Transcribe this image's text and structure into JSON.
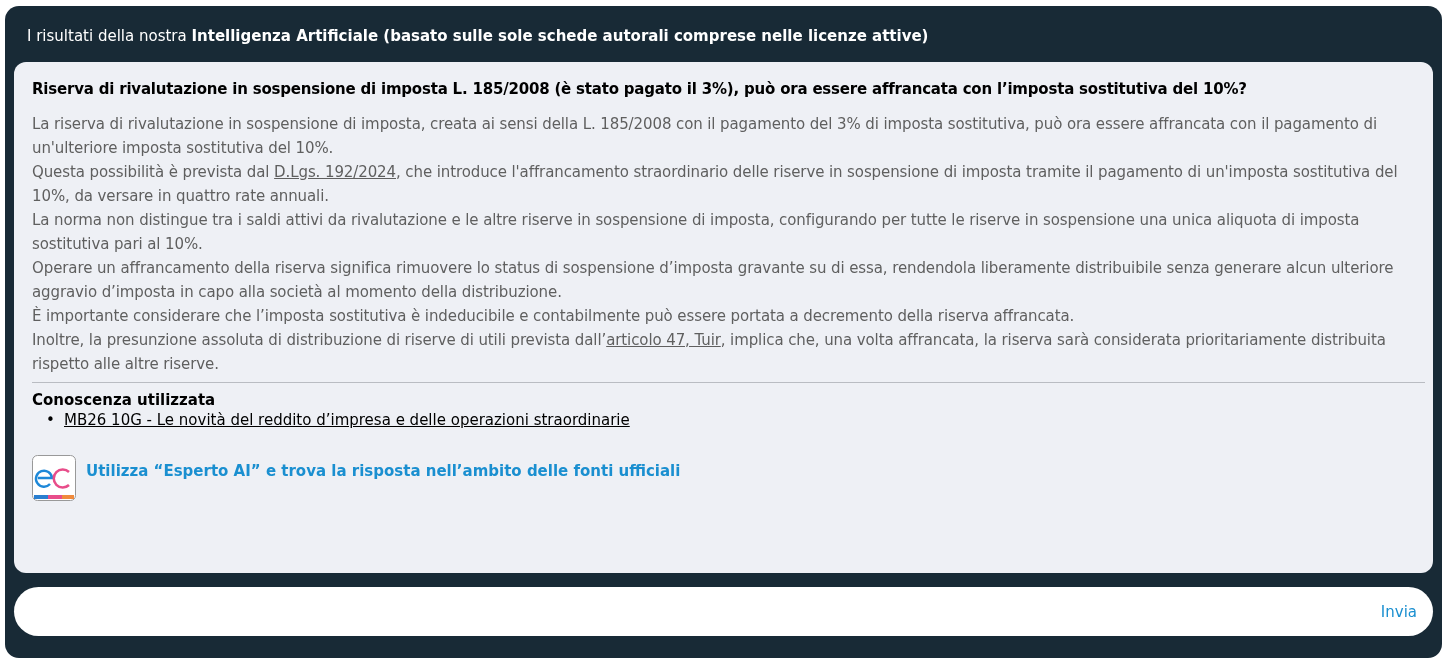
{
  "header": {
    "text": "I risultati della nostra **Intelligenza Artificiale (basato sulle sole schede autorali comprese nelle licenze attive)**"
  },
  "answer": {
    "question": "Riserva di rivalutazione in sospensione di imposta L. 185/2008 (è stato pagato il 3%), può ora essere affrancata con l’imposta sostitutiva del 10%?",
    "paragraphs": [
      [
        {
          "kind": "text",
          "text": "La riserva di rivalutazione in sospensione di imposta, creata ai sensi della L. 185/2008 con il pagamento del 3% di imposta sostitutiva, può ora essere affrancata con il pagamento di un'ulteriore imposta sostitutiva del 10%."
        }
      ],
      [
        {
          "kind": "text",
          "text": "Questa possibilità è prevista dal "
        },
        {
          "kind": "link",
          "text": "D.Lgs. 192/2024"
        },
        {
          "kind": "text",
          "text": ", che introduce l'affrancamento straordinario delle riserve in sospensione di imposta tramite il pagamento di un'imposta sostitutiva del 10%, da versare in quattro rate annuali."
        }
      ],
      [
        {
          "kind": "text",
          "text": "La norma non distingue tra i saldi attivi da rivalutazione e le altre riserve in sospensione di imposta, configurando per tutte le riserve in sospensione una unica aliquota di imposta sostitutiva pari al 10%."
        }
      ],
      [
        {
          "kind": "text",
          "text": "Operare un affrancamento della riserva significa rimuovere lo status di sospensione d’imposta gravante su di essa, rendendola liberamente distribuibile senza generare alcun ulteriore aggravio d’imposta in capo alla società al momento della distribuzione."
        }
      ],
      [
        {
          "kind": "text",
          "text": "È importante considerare che l’imposta sostitutiva è indeducibile e contabilmente può essere portata a decremento della riserva affrancata."
        }
      ],
      [
        {
          "kind": "text",
          "text": "Inoltre, la presunzione assoluta di distribuzione di riserve di utili prevista dall’"
        },
        {
          "kind": "link",
          "text": "articolo 47, Tuir"
        },
        {
          "kind": "text",
          "text": ", implica che, una volta affrancata, la riserva sarà considerata prioritariamente distribuita rispetto alle altre riserve."
        }
      ]
    ],
    "sources_title": "Conoscenza utilizzata",
    "sources": [
      {
        "bullet": "•",
        "title": "MB26 10G - Le novità del reddito d’impresa e delle operazioni straordinarie"
      }
    ],
    "promo": "Utilizza “Esperto AI” e trova la risposta nell’ambito delle fonti ufficiali"
  },
  "composer": {
    "button": "Invia"
  }
}
